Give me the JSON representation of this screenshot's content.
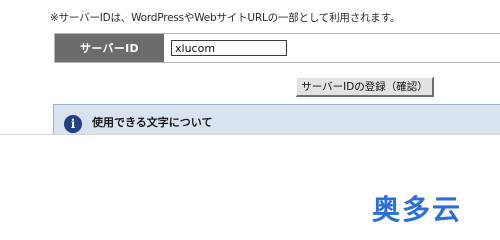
{
  "note": "※サーバーIDは、WordPressやWebサイトURLの一部として利用されます。",
  "form": {
    "label": "サーバーID",
    "input_value": "xlucom"
  },
  "submit_label": "サーバーIDの登録（確認）",
  "info": {
    "icon": "info-icon",
    "title": "使用できる文字について"
  },
  "watermark": "奥多云",
  "colors": {
    "label_bg": "#6b6b6b",
    "info_bg": "#d9e2ef",
    "info_icon": "#233f85",
    "watermark": "#2b6fd6"
  }
}
